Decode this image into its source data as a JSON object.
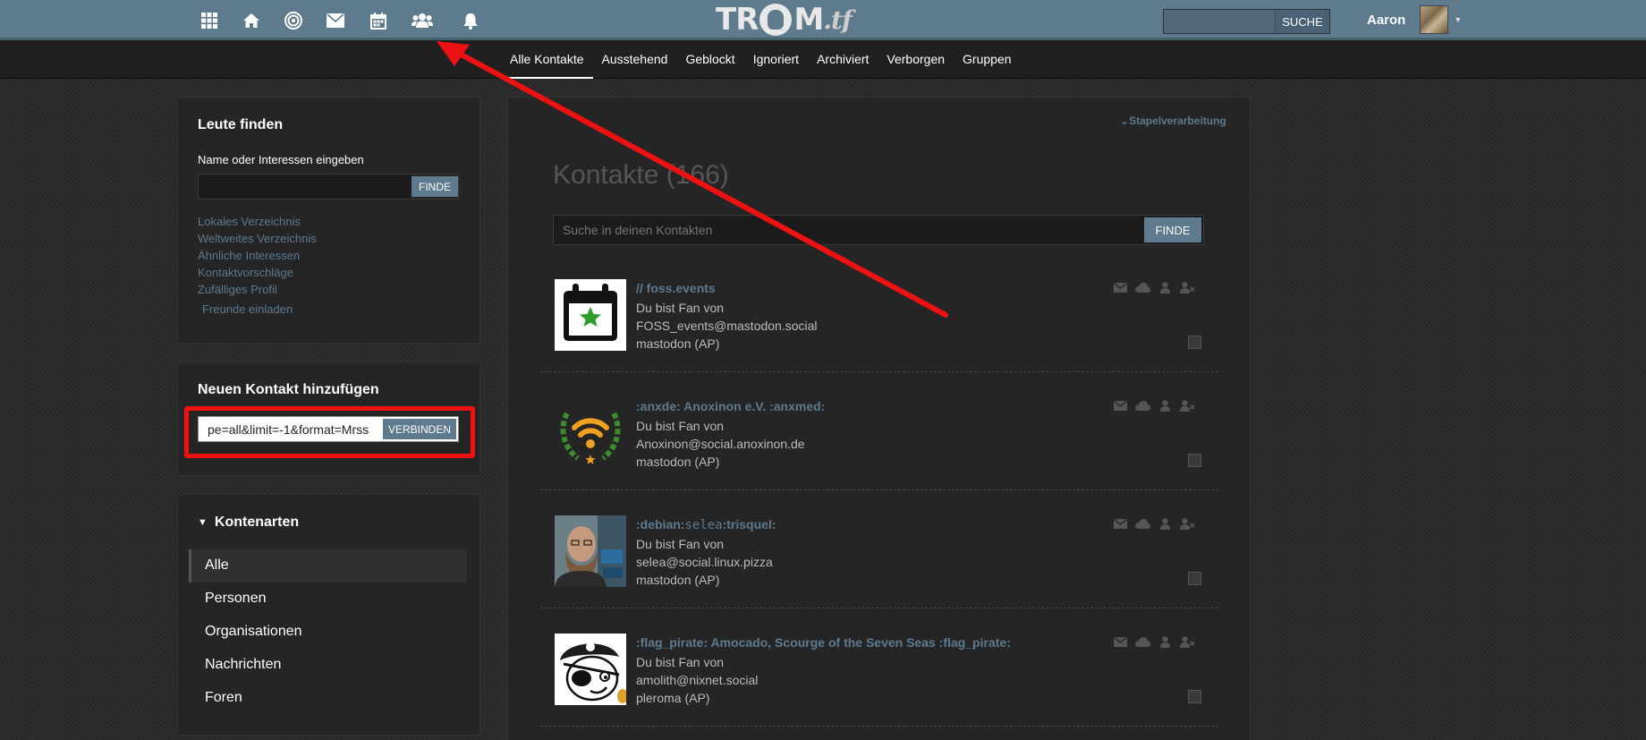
{
  "topbar": {
    "logo": {
      "part1": "TR",
      "part2": "M",
      "part3": ".tf"
    },
    "search": {
      "placeholder": "",
      "button": "SUCHE"
    },
    "user": {
      "name": "Aaron"
    }
  },
  "subnav": {
    "tabs": [
      {
        "label": "Alle Kontakte"
      },
      {
        "label": "Ausstehend"
      },
      {
        "label": "Geblockt"
      },
      {
        "label": "Ignoriert"
      },
      {
        "label": "Archiviert"
      },
      {
        "label": "Verborgen"
      },
      {
        "label": "Gruppen"
      }
    ]
  },
  "find_people": {
    "title": "Leute finden",
    "label": "Name oder Interessen eingeben",
    "input_value": "",
    "button": "FINDE",
    "links": [
      "Lokales Verzeichnis",
      "Weltweites Verzeichnis",
      "Ähnliche Interessen",
      "Kontaktvorschläge",
      "Zufälliges Profil"
    ],
    "invite": "Freunde einladen"
  },
  "add_contact": {
    "title": "Neuen Kontakt hinzufügen",
    "input_value": "pe=all&limit=-1&format=Mrss",
    "button": "VERBINDEN"
  },
  "account_types": {
    "title": "Kontenarten",
    "items": [
      "Alle",
      "Personen",
      "Organisationen",
      "Nachrichten",
      "Foren"
    ]
  },
  "contacts": {
    "batch": "Stapelverarbeitung",
    "title": "Kontakte (166)",
    "search_placeholder": "Suche in deinen Kontakten",
    "search_button": "FINDE",
    "list": [
      {
        "name": "// foss.events",
        "relation": "Du bist Fan von",
        "handle": "FOSS_events@mastodon.social",
        "network": "mastodon (AP)"
      },
      {
        "name": ":anxde: Anoxinon e.V. :anxmed:",
        "relation": "Du bist Fan von",
        "handle": "Anoxinon@social.anoxinon.de",
        "network": "mastodon (AP)"
      },
      {
        "name_a": ":debian:",
        "name_b": "selea",
        "name_c": ":trisquel:",
        "relation": "Du bist Fan von",
        "handle": "selea@social.linux.pizza",
        "network": "mastodon (AP)"
      },
      {
        "name": ":flag_pirate: Amocado, Scourge of the Seven Seas :flag_pirate:",
        "relation": "Du bist Fan von",
        "handle": "amolith@nixnet.social",
        "network": "pleroma (AP)"
      }
    ]
  },
  "colors": {
    "topbar": "#5e7a8d",
    "accent_link": "#5c7a8f",
    "highlight_red": "#ee1111"
  }
}
